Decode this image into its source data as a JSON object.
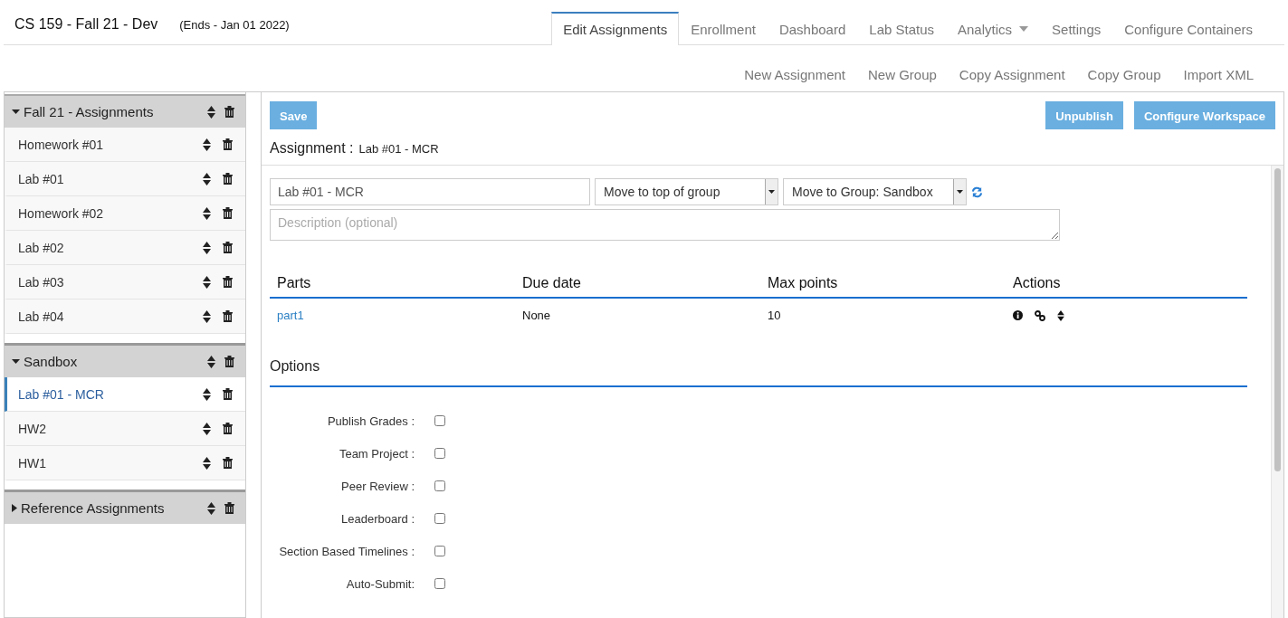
{
  "course": {
    "title": "CS 159 - Fall 21 - Dev",
    "ends": "(Ends - Jan 01 2022)"
  },
  "tabs": [
    {
      "label": "Edit Assignments",
      "selected": true,
      "has_menu": false
    },
    {
      "label": "Enrollment",
      "selected": false,
      "has_menu": false
    },
    {
      "label": "Dashboard",
      "selected": false,
      "has_menu": false
    },
    {
      "label": "Lab Status",
      "selected": false,
      "has_menu": false
    },
    {
      "label": "Analytics",
      "selected": false,
      "has_menu": true
    },
    {
      "label": "Settings",
      "selected": false,
      "has_menu": false
    },
    {
      "label": "Configure Containers",
      "selected": false,
      "has_menu": false
    }
  ],
  "actions": [
    "New Assignment",
    "New Group",
    "Copy Assignment",
    "Copy Group",
    "Import XML"
  ],
  "groups": [
    {
      "label": "Fall 21 - Assignments",
      "expanded": true,
      "items": [
        {
          "label": "Homework #01",
          "selected": false
        },
        {
          "label": "Lab #01",
          "selected": false
        },
        {
          "label": "Homework #02",
          "selected": false
        },
        {
          "label": "Lab #02",
          "selected": false
        },
        {
          "label": "Lab #03",
          "selected": false
        },
        {
          "label": "Lab #04",
          "selected": false
        }
      ]
    },
    {
      "label": "Sandbox",
      "expanded": true,
      "items": [
        {
          "label": "Lab #01 - MCR",
          "selected": true
        },
        {
          "label": "HW2",
          "selected": false
        },
        {
          "label": "HW1",
          "selected": false
        }
      ]
    },
    {
      "label": "Reference Assignments",
      "expanded": false
    }
  ],
  "editor": {
    "save": "Save",
    "unpublish": "Unpublish",
    "configure": "Configure Workspace",
    "assignment_label": "Assignment :",
    "assignment_name": "Lab #01 - MCR",
    "name_value": "Lab #01 - MCR",
    "position_select": "Move to top of group",
    "group_select": "Move to Group: Sandbox",
    "description_placeholder": "Description (optional)"
  },
  "parts_table": {
    "columns": [
      "Parts",
      "Due date",
      "Max points",
      "Actions"
    ],
    "rows": [
      {
        "part": "part1",
        "due": "None",
        "points": "10"
      }
    ]
  },
  "options": {
    "title": "Options",
    "items": [
      {
        "label": "Publish Grades :",
        "checked": false
      },
      {
        "label": "Team Project :",
        "checked": false
      },
      {
        "label": "Peer Review :",
        "checked": false
      },
      {
        "label": "Leaderboard :",
        "checked": false
      },
      {
        "label": "Section Based Timelines :",
        "checked": false
      },
      {
        "label": "Auto-Submit:",
        "checked": false
      }
    ]
  }
}
